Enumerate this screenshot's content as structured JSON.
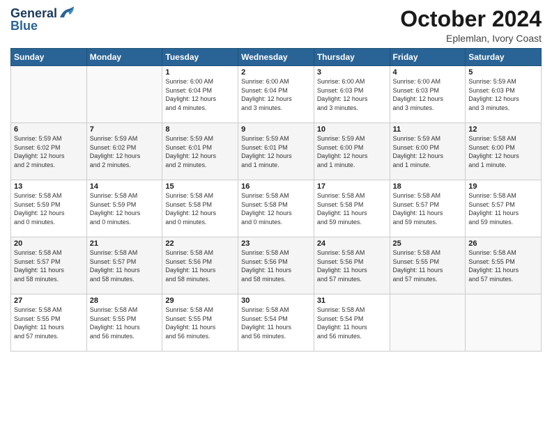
{
  "logo": {
    "line1": "General",
    "line2": "Blue"
  },
  "title": "October 2024",
  "location": "Eplemlan, Ivory Coast",
  "weekdays": [
    "Sunday",
    "Monday",
    "Tuesday",
    "Wednesday",
    "Thursday",
    "Friday",
    "Saturday"
  ],
  "weeks": [
    [
      {
        "day": "",
        "info": ""
      },
      {
        "day": "",
        "info": ""
      },
      {
        "day": "1",
        "info": "Sunrise: 6:00 AM\nSunset: 6:04 PM\nDaylight: 12 hours\nand 4 minutes."
      },
      {
        "day": "2",
        "info": "Sunrise: 6:00 AM\nSunset: 6:04 PM\nDaylight: 12 hours\nand 3 minutes."
      },
      {
        "day": "3",
        "info": "Sunrise: 6:00 AM\nSunset: 6:03 PM\nDaylight: 12 hours\nand 3 minutes."
      },
      {
        "day": "4",
        "info": "Sunrise: 6:00 AM\nSunset: 6:03 PM\nDaylight: 12 hours\nand 3 minutes."
      },
      {
        "day": "5",
        "info": "Sunrise: 5:59 AM\nSunset: 6:03 PM\nDaylight: 12 hours\nand 3 minutes."
      }
    ],
    [
      {
        "day": "6",
        "info": "Sunrise: 5:59 AM\nSunset: 6:02 PM\nDaylight: 12 hours\nand 2 minutes."
      },
      {
        "day": "7",
        "info": "Sunrise: 5:59 AM\nSunset: 6:02 PM\nDaylight: 12 hours\nand 2 minutes."
      },
      {
        "day": "8",
        "info": "Sunrise: 5:59 AM\nSunset: 6:01 PM\nDaylight: 12 hours\nand 2 minutes."
      },
      {
        "day": "9",
        "info": "Sunrise: 5:59 AM\nSunset: 6:01 PM\nDaylight: 12 hours\nand 1 minute."
      },
      {
        "day": "10",
        "info": "Sunrise: 5:59 AM\nSunset: 6:00 PM\nDaylight: 12 hours\nand 1 minute."
      },
      {
        "day": "11",
        "info": "Sunrise: 5:59 AM\nSunset: 6:00 PM\nDaylight: 12 hours\nand 1 minute."
      },
      {
        "day": "12",
        "info": "Sunrise: 5:58 AM\nSunset: 6:00 PM\nDaylight: 12 hours\nand 1 minute."
      }
    ],
    [
      {
        "day": "13",
        "info": "Sunrise: 5:58 AM\nSunset: 5:59 PM\nDaylight: 12 hours\nand 0 minutes."
      },
      {
        "day": "14",
        "info": "Sunrise: 5:58 AM\nSunset: 5:59 PM\nDaylight: 12 hours\nand 0 minutes."
      },
      {
        "day": "15",
        "info": "Sunrise: 5:58 AM\nSunset: 5:58 PM\nDaylight: 12 hours\nand 0 minutes."
      },
      {
        "day": "16",
        "info": "Sunrise: 5:58 AM\nSunset: 5:58 PM\nDaylight: 12 hours\nand 0 minutes."
      },
      {
        "day": "17",
        "info": "Sunrise: 5:58 AM\nSunset: 5:58 PM\nDaylight: 11 hours\nand 59 minutes."
      },
      {
        "day": "18",
        "info": "Sunrise: 5:58 AM\nSunset: 5:57 PM\nDaylight: 11 hours\nand 59 minutes."
      },
      {
        "day": "19",
        "info": "Sunrise: 5:58 AM\nSunset: 5:57 PM\nDaylight: 11 hours\nand 59 minutes."
      }
    ],
    [
      {
        "day": "20",
        "info": "Sunrise: 5:58 AM\nSunset: 5:57 PM\nDaylight: 11 hours\nand 58 minutes."
      },
      {
        "day": "21",
        "info": "Sunrise: 5:58 AM\nSunset: 5:57 PM\nDaylight: 11 hours\nand 58 minutes."
      },
      {
        "day": "22",
        "info": "Sunrise: 5:58 AM\nSunset: 5:56 PM\nDaylight: 11 hours\nand 58 minutes."
      },
      {
        "day": "23",
        "info": "Sunrise: 5:58 AM\nSunset: 5:56 PM\nDaylight: 11 hours\nand 58 minutes."
      },
      {
        "day": "24",
        "info": "Sunrise: 5:58 AM\nSunset: 5:56 PM\nDaylight: 11 hours\nand 57 minutes."
      },
      {
        "day": "25",
        "info": "Sunrise: 5:58 AM\nSunset: 5:55 PM\nDaylight: 11 hours\nand 57 minutes."
      },
      {
        "day": "26",
        "info": "Sunrise: 5:58 AM\nSunset: 5:55 PM\nDaylight: 11 hours\nand 57 minutes."
      }
    ],
    [
      {
        "day": "27",
        "info": "Sunrise: 5:58 AM\nSunset: 5:55 PM\nDaylight: 11 hours\nand 57 minutes."
      },
      {
        "day": "28",
        "info": "Sunrise: 5:58 AM\nSunset: 5:55 PM\nDaylight: 11 hours\nand 56 minutes."
      },
      {
        "day": "29",
        "info": "Sunrise: 5:58 AM\nSunset: 5:55 PM\nDaylight: 11 hours\nand 56 minutes."
      },
      {
        "day": "30",
        "info": "Sunrise: 5:58 AM\nSunset: 5:54 PM\nDaylight: 11 hours\nand 56 minutes."
      },
      {
        "day": "31",
        "info": "Sunrise: 5:58 AM\nSunset: 5:54 PM\nDaylight: 11 hours\nand 56 minutes."
      },
      {
        "day": "",
        "info": ""
      },
      {
        "day": "",
        "info": ""
      }
    ]
  ]
}
